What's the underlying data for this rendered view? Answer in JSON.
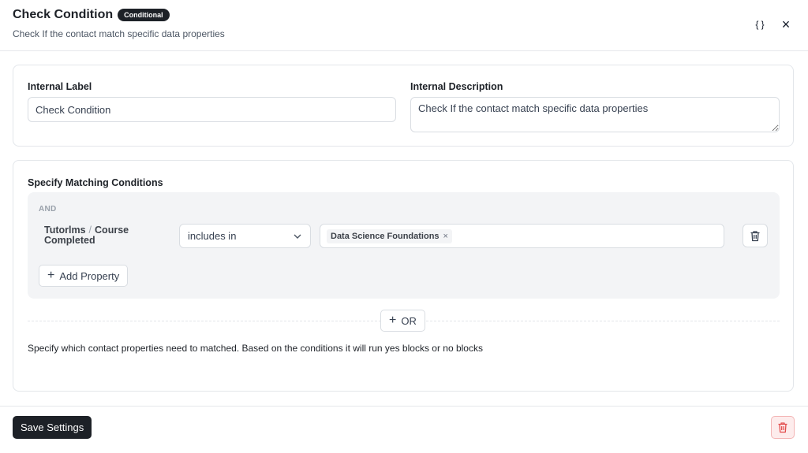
{
  "header": {
    "title": "Check Condition",
    "badge": "Conditional",
    "subtitle": "Check If the contact match specific data properties",
    "json_icon": "{ }",
    "close_icon": "×"
  },
  "labels_card": {
    "internal_label": {
      "label": "Internal Label",
      "value": "Check Condition"
    },
    "internal_description": {
      "label": "Internal Description",
      "value": "Check If the contact match specific data properties"
    }
  },
  "conditions_card": {
    "title": "Specify Matching Conditions",
    "group_operator": "AND",
    "rule": {
      "property_source": "Tutorlms",
      "property_separator": "/",
      "property_field": "Course Completed",
      "operator": "includes in",
      "tags": [
        {
          "label": "Data Science Foundations",
          "remove": "×"
        }
      ]
    },
    "add_property_label": "Add Property",
    "or_label": "OR",
    "help_text": "Specify which contact properties need to matched. Based on the conditions it will run yes blocks or no blocks"
  },
  "footer": {
    "save_label": "Save Settings"
  },
  "colors": {
    "primary": "#1d2127",
    "danger": "#e24c4c",
    "danger_bg": "#fdecec"
  },
  "icons": {
    "json": "braces-icon",
    "close": "close-icon",
    "dropdown": "chevron-down-icon",
    "remove_rule": "trash-icon",
    "add": "plus-icon",
    "delete": "trash-icon"
  }
}
